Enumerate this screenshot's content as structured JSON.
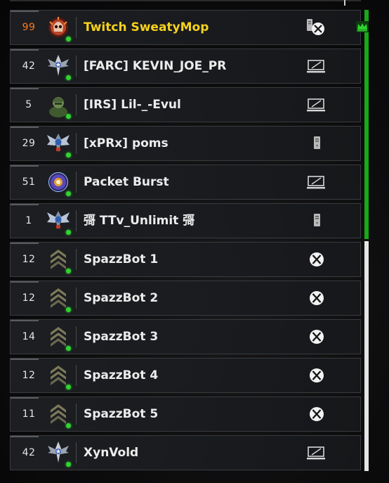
{
  "colors": {
    "team_a": "#18a818",
    "team_b": "#e4e4e4",
    "host_name": "#f6d21c",
    "host_level": "#ff7a1a",
    "online": "#31d431"
  },
  "players": [
    {
      "level": "99",
      "name": "Twitch SweatyMop",
      "rank_icon": "prestige-skull-emblem-icon",
      "platform": "pc-xbox-crossplay-icon",
      "host": true,
      "team": "a"
    },
    {
      "level": "42",
      "name": "[FARC] KEVIN_JOE_PR",
      "rank_icon": "winged-star-rank-icon",
      "platform": "mnk-icon",
      "team": "a"
    },
    {
      "level": "5",
      "name": "[IRS] Lil-_-Evul",
      "rank_icon": "soldier-portrait-icon",
      "platform": "mnk-icon",
      "team": "a"
    },
    {
      "level": "29",
      "name": "[xPRx] poms",
      "rank_icon": "winged-eagle-rank-icon",
      "platform": "pc-tower-icon",
      "team": "a"
    },
    {
      "level": "51",
      "name": "Packet Burst",
      "rank_icon": "purple-orb-emblem-icon",
      "platform": "mnk-icon",
      "team": "a"
    },
    {
      "level": "1",
      "name": "彁 TTv_Unlimit 彁",
      "rank_icon": "winged-eagle-rank-icon",
      "platform": "pc-tower-icon",
      "team": "a"
    },
    {
      "level": "12",
      "name": "SpazzBot 1",
      "rank_icon": "sergeant-chevron-icon",
      "platform": "xbox-icon",
      "team": "b"
    },
    {
      "level": "12",
      "name": "SpazzBot 2",
      "rank_icon": "sergeant-chevron-icon",
      "platform": "xbox-icon",
      "team": "b"
    },
    {
      "level": "14",
      "name": "SpazzBot 3",
      "rank_icon": "sergeant-chevron-icon",
      "platform": "xbox-icon",
      "team": "b"
    },
    {
      "level": "12",
      "name": "SpazzBot 4",
      "rank_icon": "sergeant-chevron-icon",
      "platform": "xbox-icon",
      "team": "b"
    },
    {
      "level": "11",
      "name": "SpazzBot 5",
      "rank_icon": "sergeant-chevron-icon",
      "platform": "xbox-icon",
      "team": "b"
    },
    {
      "level": "42",
      "name": "XynVold",
      "rank_icon": "winged-star-rank-icon",
      "platform": "mnk-icon",
      "team": "b"
    }
  ]
}
